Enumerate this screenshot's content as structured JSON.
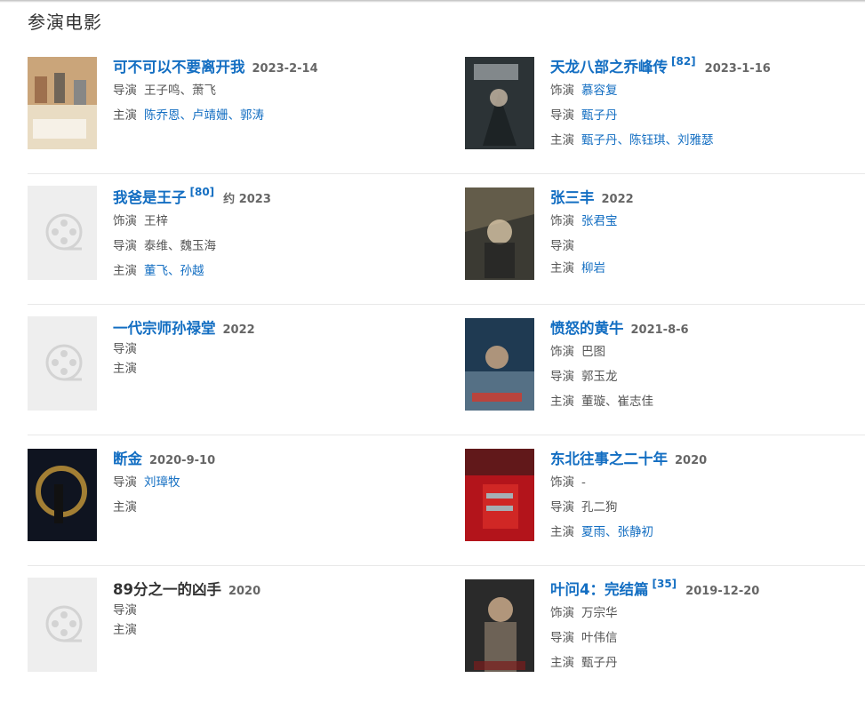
{
  "section_title": "参演电影",
  "poster_colors": {
    "m1": [
      "#caa57a",
      "#e9dcc3"
    ],
    "m2": [
      "#2c3336",
      "#7c8489"
    ],
    "m4": [
      "#3b3a33",
      "#7e735a"
    ],
    "m6": [
      "#1f3a52",
      "#7a95a8"
    ],
    "m7": [
      "#0f1420",
      "#c89a3a"
    ],
    "m8": [
      "#b3141b",
      "#e2342d"
    ],
    "m10": [
      "#2a2a2a",
      "#8a7a6a"
    ]
  },
  "movies": [
    {
      "title": "可不可以不要离开我",
      "date": "2023-2-14",
      "director_label": "导演",
      "director": "王子鸣、萧飞",
      "star_label": "主演",
      "stars": "陈乔恩、卢靖姗、郭涛"
    },
    {
      "title": "天龙八部之乔峰传",
      "score": "[82]",
      "date": "2023-1-16",
      "role_label": "饰演",
      "role": "慕容复",
      "director_label": "导演",
      "director": "甄子丹",
      "star_label": "主演",
      "stars": "甄子丹、陈钰琪、刘雅瑟"
    },
    {
      "title": "我爸是王子",
      "score": "[80]",
      "date": "约 2023",
      "role_label": "饰演",
      "role": "王梓",
      "director_label": "导演",
      "director": "泰维、魏玉海",
      "star_label": "主演",
      "stars": "董飞、孙越"
    },
    {
      "title": "张三丰",
      "date": "2022",
      "role_label": "饰演",
      "role": "张君宝",
      "director_label": "导演",
      "director": "",
      "star_label": "主演",
      "stars": "柳岩"
    },
    {
      "title": "一代宗师孙禄堂",
      "date": "2022",
      "director_label": "导演",
      "star_label": "主演"
    },
    {
      "title": "愤怒的黄牛",
      "date": "2021-8-6",
      "role_label": "饰演",
      "role": "巴图",
      "director_label": "导演",
      "director": "郭玉龙",
      "star_label": "主演",
      "stars": "董璇、崔志佳"
    },
    {
      "title": "断金",
      "date": "2020-9-10",
      "director_label": "导演",
      "director": "刘璋牧",
      "star_label": "主演"
    },
    {
      "title": "东北往事之二十年",
      "date": "2020",
      "role_label": "饰演",
      "role": "-",
      "director_label": "导演",
      "director": "孔二狗",
      "star_label": "主演",
      "stars": "夏雨、张静初"
    },
    {
      "title": "89分之一的凶手",
      "date": "2020",
      "director_label": "导演",
      "star_label": "主演"
    },
    {
      "title": "叶问4：完结篇",
      "score": "[35]",
      "date": "2019-12-20",
      "role_label": "饰演",
      "role": "万宗华",
      "director_label": "导演",
      "director": "叶伟信",
      "star_label": "主演",
      "stars": "甄子丹"
    }
  ]
}
